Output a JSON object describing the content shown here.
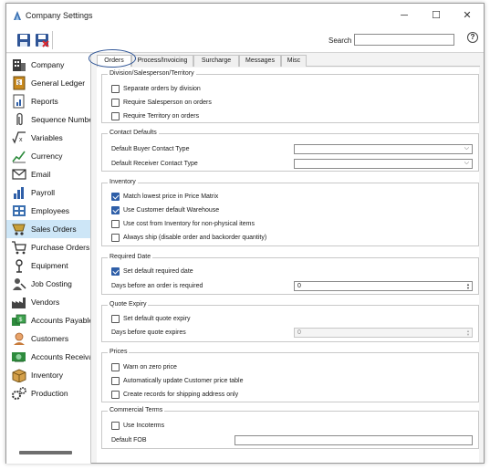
{
  "window": {
    "title": "Company Settings"
  },
  "titlebar": {
    "minimize": "─",
    "maximize": "☐",
    "close": "✕"
  },
  "toolbar": {
    "search_label": "Search",
    "search_value": "",
    "help": "?"
  },
  "sidebar": {
    "items": [
      {
        "label": "Company",
        "icon": "building-icon"
      },
      {
        "label": "General Ledger",
        "icon": "ledger-icon"
      },
      {
        "label": "Reports",
        "icon": "reports-icon"
      },
      {
        "label": "Sequence Numbe",
        "icon": "paperclip-icon"
      },
      {
        "label": "Variables",
        "icon": "variables-icon"
      },
      {
        "label": "Currency",
        "icon": "currency-icon"
      },
      {
        "label": "Email",
        "icon": "envelope-icon"
      },
      {
        "label": "Payroll",
        "icon": "payroll-icon"
      },
      {
        "label": "Employees",
        "icon": "employees-icon"
      },
      {
        "label": "Sales Orders",
        "icon": "sales-orders-icon",
        "active": true
      },
      {
        "label": "Purchase Orders",
        "icon": "cart-icon"
      },
      {
        "label": "Equipment",
        "icon": "equipment-icon"
      },
      {
        "label": "Job Costing",
        "icon": "job-costing-icon"
      },
      {
        "label": "Vendors",
        "icon": "factory-icon"
      },
      {
        "label": "Accounts Payable",
        "icon": "accounts-payable-icon"
      },
      {
        "label": "Customers",
        "icon": "customers-icon"
      },
      {
        "label": "Accounts Receival",
        "icon": "accounts-receivable-icon"
      },
      {
        "label": "Inventory",
        "icon": "box-icon"
      },
      {
        "label": "Production",
        "icon": "gears-icon"
      }
    ]
  },
  "tabs": [
    {
      "label": "Orders",
      "active": true
    },
    {
      "label": "Process/Invoicing"
    },
    {
      "label": "Surcharge"
    },
    {
      "label": "Messages"
    },
    {
      "label": "Misc"
    }
  ],
  "groups": {
    "division": {
      "title": "Division/Salesperson/Territory",
      "options": [
        {
          "label": "Separate orders by division",
          "checked": false
        },
        {
          "label": "Require Salesperson on orders",
          "checked": false
        },
        {
          "label": "Require Territory on orders",
          "checked": false
        }
      ]
    },
    "contact": {
      "title": "Contact Defaults",
      "buyer_label": "Default Buyer Contact Type",
      "buyer_value": "",
      "receiver_label": "Default Receiver Contact Type",
      "receiver_value": ""
    },
    "inventory": {
      "title": "Inventory",
      "options": [
        {
          "label": "Match lowest price in Price Matrix",
          "checked": true
        },
        {
          "label": "Use Customer default Warehouse",
          "checked": true
        },
        {
          "label": "Use cost from Inventory for non-physical items",
          "checked": false
        },
        {
          "label": "Always ship (disable order and backorder quantity)",
          "checked": false
        }
      ]
    },
    "required_date": {
      "title": "Required Date",
      "option": {
        "label": "Set default required date",
        "checked": true
      },
      "days_label": "Days before an order is required",
      "days_value": "0"
    },
    "quote_expiry": {
      "title": "Quote Expiry",
      "option": {
        "label": "Set default quote expiry",
        "checked": false
      },
      "days_label": "Days before quote expires",
      "days_value": "0"
    },
    "prices": {
      "title": "Prices",
      "options": [
        {
          "label": "Warn on zero price",
          "checked": false
        },
        {
          "label": "Automatically update Customer price table",
          "checked": false
        },
        {
          "label": "Create records for shipping address only",
          "checked": false
        }
      ]
    },
    "commercial": {
      "title": "Commercial Terms",
      "option": {
        "label": "Use Incoterms",
        "checked": false
      },
      "fob_label": "Default FOB",
      "fob_value": ""
    }
  },
  "colors": {
    "accent": "#2f5fa8",
    "active_row": "#cde6f7",
    "tab_highlight": "#2f5597"
  }
}
